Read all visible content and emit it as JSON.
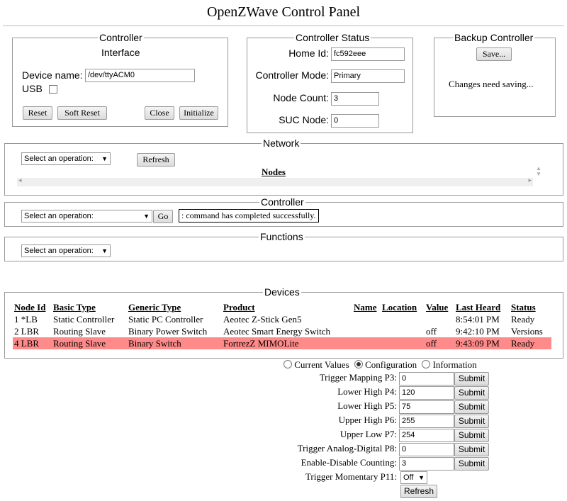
{
  "title": "OpenZWave Control Panel",
  "controller": {
    "legend": "Controller",
    "subtitle": "Interface",
    "device_label": "Device name:",
    "device_value": "/dev/ttyACM0",
    "usb_label": "USB",
    "buttons": {
      "reset": "Reset",
      "soft_reset": "Soft Reset",
      "close": "Close",
      "initialize": "Initialize"
    }
  },
  "status": {
    "legend": "Controller Status",
    "home_id_label": "Home Id:",
    "home_id": "fc592eee",
    "mode_label": "Controller Mode:",
    "mode": "Primary",
    "node_count_label": "Node Count:",
    "node_count": "3",
    "suc_label": "SUC Node:",
    "suc": "0"
  },
  "backup": {
    "legend": "Backup Controller",
    "save_label": "Save...",
    "message": "Changes need saving..."
  },
  "network": {
    "legend": "Network",
    "select": "Select an operation:",
    "refresh": "Refresh",
    "nodes_heading": "Nodes"
  },
  "controller_ops": {
    "legend": "Controller",
    "select": "Select an operation:",
    "go": "Go",
    "message": ": command has completed successfully."
  },
  "functions": {
    "legend": "Functions",
    "select": "Select an operation:"
  },
  "devices": {
    "legend": "Devices",
    "columns": [
      "Node Id",
      "Basic Type",
      "Generic Type",
      "Product",
      "Name",
      "Location",
      "Value",
      "Last Heard",
      "Status"
    ],
    "rows": [
      [
        "1 *LB",
        "Static Controller",
        "Static PC Controller",
        "Aeotec Z-Stick Gen5",
        "",
        "",
        "",
        "8:54:01 PM",
        "Ready"
      ],
      [
        "2 LBR",
        "Routing Slave",
        "Binary Power Switch",
        "Aeotec Smart Energy Switch",
        "",
        "",
        "off",
        "9:42:10 PM",
        "Versions"
      ],
      [
        "4 LBR",
        "Routing Slave",
        "Binary Switch",
        "FortrezZ MIMOLite",
        "",
        "",
        "off",
        "9:43:09 PM",
        "Ready"
      ]
    ],
    "highlight_color": "#ff8a8a"
  },
  "config": {
    "radios": [
      {
        "label": "Current Values",
        "selected": false
      },
      {
        "label": "Configuration",
        "selected": true
      },
      {
        "label": "Information",
        "selected": false
      }
    ],
    "params": [
      {
        "label": "Trigger Mapping P3:",
        "value": "0",
        "submit": "Submit"
      },
      {
        "label": "Lower High P4:",
        "value": "120",
        "submit": "Submit"
      },
      {
        "label": "Lower High P5:",
        "value": "75",
        "submit": "Submit"
      },
      {
        "label": "Upper High P6:",
        "value": "255",
        "submit": "Submit"
      },
      {
        "label": "Upper Low P7:",
        "value": "254",
        "submit": "Submit"
      },
      {
        "label": "Trigger Analog-Digital P8:",
        "value": "0",
        "submit": "Submit"
      },
      {
        "label": "Enable-Disable Counting:",
        "value": "3",
        "submit": "Submit"
      }
    ],
    "momentary_label": "Trigger Momentary P11:",
    "momentary_value": "Off",
    "refresh": "Refresh"
  }
}
